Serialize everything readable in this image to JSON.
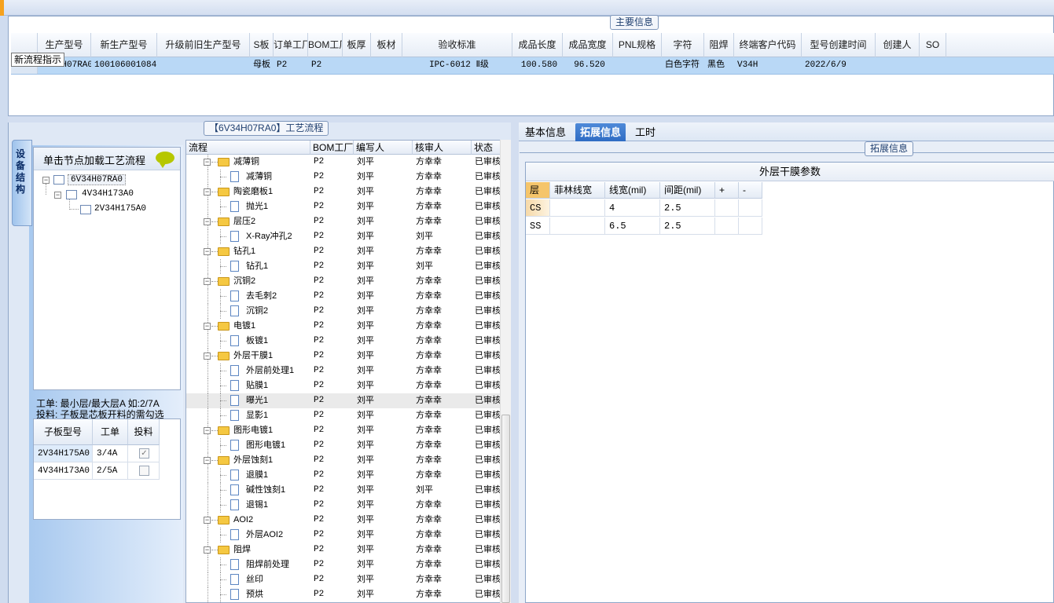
{
  "main_info": {
    "title": "主要信息",
    "columns": [
      "生产型号",
      "新生产型号",
      "升级前旧生产型号",
      "S板",
      "订单工厂",
      "BOM工厂",
      "板厚",
      "板材",
      "验收标准",
      "成品长度",
      "成品宽度",
      "PNL规格",
      "字符",
      "阻焊",
      "终端客户代码",
      "型号创建时间",
      "创建人",
      "SO"
    ],
    "row": [
      "6V34H07RA0",
      "10010600108423",
      "",
      "母板",
      "P2",
      "P2",
      "",
      "",
      "IPC-6012 Ⅱ级",
      "100.580",
      "96.520",
      "",
      "白色字符",
      "黑色",
      "V34H",
      "2022/6/9",
      "",
      ""
    ],
    "tooltip": "新流程指示"
  },
  "process": {
    "title": "【6V34H07RA0】工艺流程",
    "columns": [
      "流程",
      "BOM工厂",
      "编写人",
      "核审人",
      "状态"
    ],
    "rows": [
      {
        "name": "减薄铜",
        "bom": "P2",
        "writer": "刘平",
        "reviewer": "方幸幸",
        "status": "已审核",
        "level": 0
      },
      {
        "name": "减薄铜",
        "bom": "P2",
        "writer": "刘平",
        "reviewer": "方幸幸",
        "status": "已审核",
        "level": 1
      },
      {
        "name": "陶瓷磨板1",
        "bom": "P2",
        "writer": "刘平",
        "reviewer": "方幸幸",
        "status": "已审核",
        "level": 0
      },
      {
        "name": "抛光1",
        "bom": "P2",
        "writer": "刘平",
        "reviewer": "方幸幸",
        "status": "已审核",
        "level": 1
      },
      {
        "name": "层压2",
        "bom": "P2",
        "writer": "刘平",
        "reviewer": "方幸幸",
        "status": "已审核",
        "level": 0
      },
      {
        "name": "X-Ray冲孔2",
        "bom": "P2",
        "writer": "刘平",
        "reviewer": "刘平",
        "status": "已审核",
        "level": 1
      },
      {
        "name": "钻孔1",
        "bom": "P2",
        "writer": "刘平",
        "reviewer": "方幸幸",
        "status": "已审核",
        "level": 0
      },
      {
        "name": "钻孔1",
        "bom": "P2",
        "writer": "刘平",
        "reviewer": "刘平",
        "status": "已审核",
        "level": 1
      },
      {
        "name": "沉铜2",
        "bom": "P2",
        "writer": "刘平",
        "reviewer": "方幸幸",
        "status": "已审核",
        "level": 0
      },
      {
        "name": "去毛刺2",
        "bom": "P2",
        "writer": "刘平",
        "reviewer": "方幸幸",
        "status": "已审核",
        "level": 1
      },
      {
        "name": "沉铜2",
        "bom": "P2",
        "writer": "刘平",
        "reviewer": "方幸幸",
        "status": "已审核",
        "level": 1
      },
      {
        "name": "电镀1",
        "bom": "P2",
        "writer": "刘平",
        "reviewer": "方幸幸",
        "status": "已审核",
        "level": 0
      },
      {
        "name": "板镀1",
        "bom": "P2",
        "writer": "刘平",
        "reviewer": "方幸幸",
        "status": "已审核",
        "level": 1
      },
      {
        "name": "外层干膜1",
        "bom": "P2",
        "writer": "刘平",
        "reviewer": "方幸幸",
        "status": "已审核",
        "level": 0
      },
      {
        "name": "外层前处理1",
        "bom": "P2",
        "writer": "刘平",
        "reviewer": "方幸幸",
        "status": "已审核",
        "level": 1
      },
      {
        "name": "贴膜1",
        "bom": "P2",
        "writer": "刘平",
        "reviewer": "方幸幸",
        "status": "已审核",
        "level": 1
      },
      {
        "name": "曝光1",
        "bom": "P2",
        "writer": "刘平",
        "reviewer": "方幸幸",
        "status": "已审核",
        "level": 1,
        "selected": true
      },
      {
        "name": "显影1",
        "bom": "P2",
        "writer": "刘平",
        "reviewer": "方幸幸",
        "status": "已审核",
        "level": 1
      },
      {
        "name": "图形电镀1",
        "bom": "P2",
        "writer": "刘平",
        "reviewer": "方幸幸",
        "status": "已审核",
        "level": 0
      },
      {
        "name": "图形电镀1",
        "bom": "P2",
        "writer": "刘平",
        "reviewer": "方幸幸",
        "status": "已审核",
        "level": 1
      },
      {
        "name": "外层蚀刻1",
        "bom": "P2",
        "writer": "刘平",
        "reviewer": "方幸幸",
        "status": "已审核",
        "level": 0
      },
      {
        "name": "退膜1",
        "bom": "P2",
        "writer": "刘平",
        "reviewer": "方幸幸",
        "status": "已审核",
        "level": 1
      },
      {
        "name": "碱性蚀刻1",
        "bom": "P2",
        "writer": "刘平",
        "reviewer": "刘平",
        "status": "已审核",
        "level": 1
      },
      {
        "name": "退锡1",
        "bom": "P2",
        "writer": "刘平",
        "reviewer": "方幸幸",
        "status": "已审核",
        "level": 1
      },
      {
        "name": "AOI2",
        "bom": "P2",
        "writer": "刘平",
        "reviewer": "方幸幸",
        "status": "已审核",
        "level": 0
      },
      {
        "name": "外层AOI2",
        "bom": "P2",
        "writer": "刘平",
        "reviewer": "方幸幸",
        "status": "已审核",
        "level": 1
      },
      {
        "name": "阻焊",
        "bom": "P2",
        "writer": "刘平",
        "reviewer": "方幸幸",
        "status": "已审核",
        "level": 0
      },
      {
        "name": "阻焊前处理",
        "bom": "P2",
        "writer": "刘平",
        "reviewer": "方幸幸",
        "status": "已审核",
        "level": 1
      },
      {
        "name": "丝印",
        "bom": "P2",
        "writer": "刘平",
        "reviewer": "方幸幸",
        "status": "已审核",
        "level": 1
      },
      {
        "name": "预烘",
        "bom": "P2",
        "writer": "刘平",
        "reviewer": "方幸幸",
        "status": "已审核",
        "level": 1
      }
    ]
  },
  "device": {
    "side_tab": "设备结构",
    "header": "单击节点加载工艺流程",
    "tree": [
      "6V34H07RA0",
      "4V34H173A0",
      "2V34H175A0"
    ],
    "info_line1": "工单: 最小层/最大层A 如:2/7A",
    "info_line2": "投料: 子板是芯板开料的需勾选",
    "sub_columns": [
      "子板型号",
      "工单",
      "投料"
    ],
    "sub_rows": [
      {
        "model": "2V34H175A0",
        "order": "3/4A",
        "feed": true
      },
      {
        "model": "4V34H173A0",
        "order": "2/5A",
        "feed": false
      }
    ]
  },
  "right": {
    "tabs": [
      "基本信息",
      "拓展信息",
      "工时"
    ],
    "active_tab": "拓展信息",
    "group_title": "拓展信息",
    "table_title": "外层干膜参数",
    "columns": [
      "层",
      "菲林线宽",
      "线宽(mil)",
      "间距(mil)",
      "+",
      "-"
    ],
    "rows": [
      {
        "layer": "CS",
        "film": "",
        "width": "4",
        "spacing": "2.5"
      },
      {
        "layer": "SS",
        "film": "",
        "width": "6.5",
        "spacing": "2.5"
      }
    ]
  },
  "colors": {
    "accent": "#2e6cc4",
    "selected_row": "#b9d8f6",
    "folder": "#f5c842"
  }
}
